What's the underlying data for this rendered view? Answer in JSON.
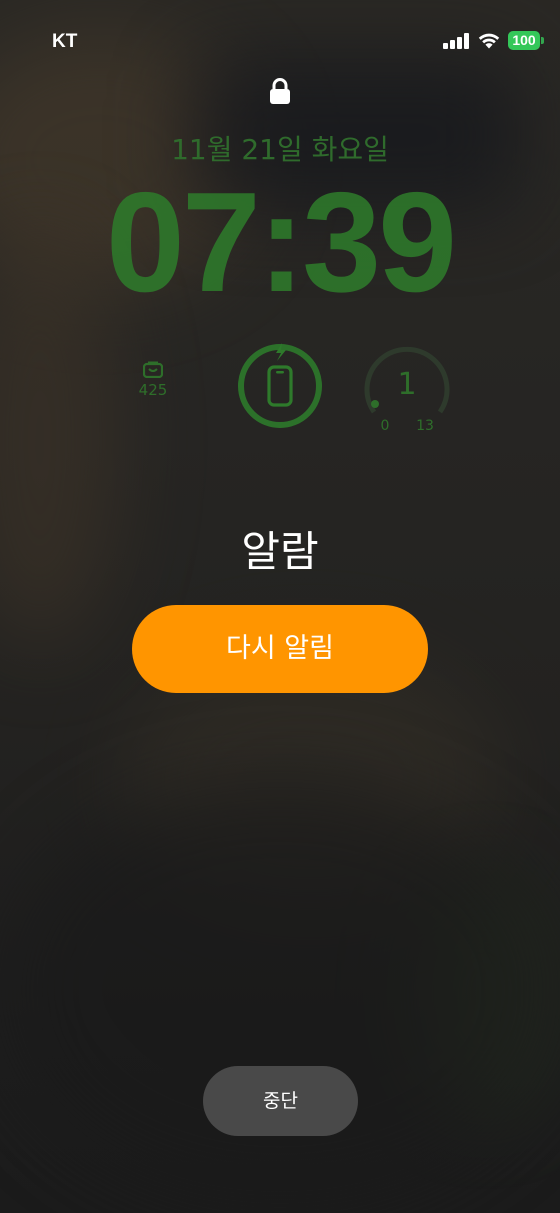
{
  "status_bar": {
    "carrier": "KT",
    "battery_level": "100",
    "signal_bars": 4,
    "icons": [
      "signal-icon",
      "wifi-icon",
      "battery-icon"
    ],
    "battery_color": "#34c759"
  },
  "lock": {
    "icon": "lock-icon"
  },
  "lock_screen": {
    "date": "11월 21일 화요일",
    "time": "07:39",
    "accent_color": "#2e7a2b"
  },
  "widgets": {
    "steps": {
      "icon": "shopping-bag-icon",
      "value": "425"
    },
    "battery_widget": {
      "icon": "phone-charging-icon"
    },
    "gauge": {
      "value": "1",
      "min": "0",
      "max": "13"
    }
  },
  "alarm": {
    "title": "알람",
    "snooze_label": "다시 알림",
    "stop_label": "중단",
    "snooze_color": "#ff9500",
    "stop_color": "#494949"
  }
}
